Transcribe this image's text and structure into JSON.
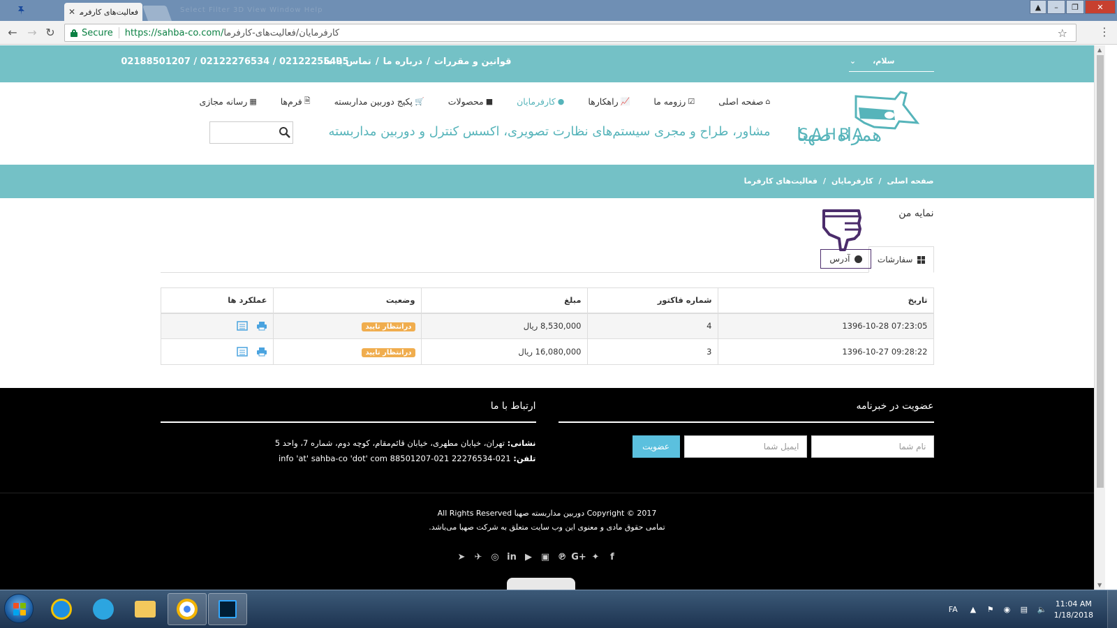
{
  "browser": {
    "tab_title": "فعالیت‌های کارفرما",
    "tab_close": "✕",
    "faded_menu": "Select  Filter  3D  View  Window  Help",
    "secure_label": "Secure",
    "url_host": "https://sahba-co.com/",
    "url_path": "کارفرمایان/فعالیت‌های-کارفرما"
  },
  "topbar": {
    "user_greeting": "سلام،",
    "links": [
      "قوانین و مقررات",
      "درباره ما",
      "تماس با ما"
    ],
    "phones": "02188501207 / 02122276534 / 02122255495"
  },
  "header": {
    "nav": [
      {
        "label": "صفحه اصلی",
        "icon": "home-icon"
      },
      {
        "label": "رزومه ما",
        "icon": "check-square-icon"
      },
      {
        "label": "راهکارها",
        "icon": "chart-icon"
      },
      {
        "label": "کارفرمایان",
        "icon": "user-icon"
      },
      {
        "label": "محصولات",
        "icon": "video-camera-icon"
      },
      {
        "label": "پکیج دوربین مداربسته",
        "icon": "cart-icon"
      },
      {
        "label": "فرم‌ها",
        "icon": "file-icon"
      },
      {
        "label": "رسانه مجازی",
        "icon": "film-icon"
      }
    ],
    "tagline": "مشاور، طراح و مجری سیستم‌های نظارت تصویری، اکسس کنترل و دوربین مداربسته",
    "logo_text_fa": "همراه صهبا",
    "logo_text_en": "SAHBA",
    "accent_color": "#56b4ba",
    "band_color": "#74c1c6"
  },
  "breadcrumb": {
    "home": "صفحه اصلی",
    "parent": "کارفرمایان",
    "current": "فعالیت‌های کارفرما",
    "sep": "/"
  },
  "profile": {
    "title": "نمایه من",
    "tabs": {
      "orders": "سفارشات",
      "address": "آدرس"
    },
    "table": {
      "headers": [
        "تاریخ",
        "شماره فاکتور",
        "مبلغ",
        "وضعیت",
        "عملکرد ها"
      ],
      "rows": [
        {
          "date": "1396-10-28 07:23:05",
          "invoice": "4",
          "amount": "8,530,000 ریال",
          "status": "درانتظار تایید"
        },
        {
          "date": "1396-10-27 09:28:22",
          "invoice": "3",
          "amount": "16,080,000 ریال",
          "status": "درانتظار تایید"
        }
      ]
    }
  },
  "footer": {
    "newsletter_title": "عضویت در خبرنامه",
    "name_placeholder": "نام شما",
    "email_placeholder": "ایمیل شما",
    "subscribe_label": "عضویت",
    "contact_title": "ارتباط با ما",
    "address_label": "نشانی:",
    "address": " تهران، خیابان مطهری، خیابان قائم‌مقام، کوچه دوم، شماره 7، واحد 5",
    "phone_label": "تلفن:",
    "phone": " 021-22276534   021-88501207   info 'at' sahba-co 'dot' com",
    "copyright": "Copyright © 2017 دوربین مداربسته صهبا All Rights Reserved",
    "rights": "تمامی حقوق مادی و معنوی این وب سایت متعلق به شرکت صهبا می‌باشد.",
    "socials": [
      "facebook-icon",
      "twitter-icon",
      "google-plus-icon",
      "pinterest-icon",
      "youtube-icon",
      "play-icon",
      "linkedin-icon",
      "instagram-icon",
      "telegram-icon",
      "send-icon"
    ]
  },
  "taskbar": {
    "lang": "FA",
    "time": "11:04 AM",
    "date": "1/18/2018"
  }
}
